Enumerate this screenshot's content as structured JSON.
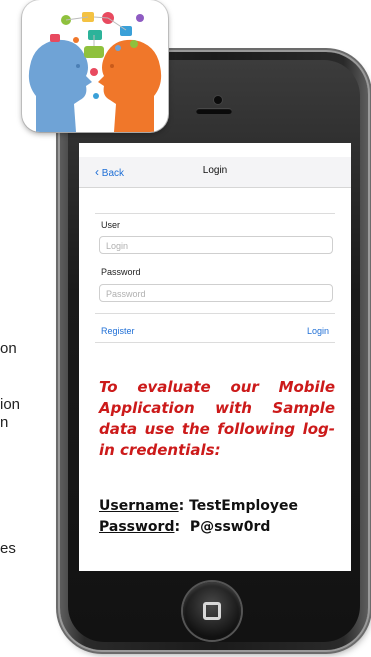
{
  "left_text": [
    "on",
    "ion",
    "n",
    "es"
  ],
  "screen": {
    "back_label": "Back",
    "title": "Login",
    "user_label": "User",
    "user_placeholder": "Login",
    "password_label": "Password",
    "password_placeholder": "Password",
    "register_label": "Register",
    "login_label": "Login"
  },
  "note": {
    "text": "To evaluate our Mobile Application with Sample data use the following log-in credentials:",
    "username_key": "Username",
    "username_value": "TestEmployee",
    "password_key": "Password",
    "password_value": "P@ssw0rd"
  },
  "colors": {
    "accent": "#1f6fd6",
    "note": "#cc1a1a"
  },
  "icons": [
    "back-chevron-icon",
    "home-button-icon",
    "two-heads-communication-logo"
  ]
}
